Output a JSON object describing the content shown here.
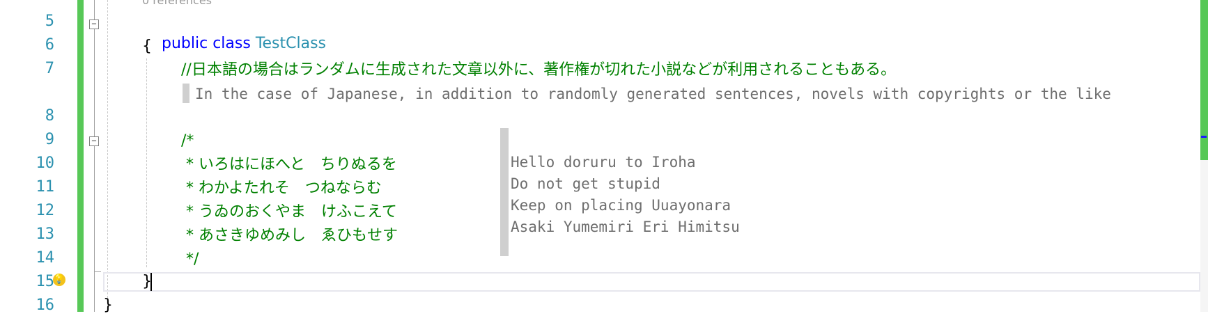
{
  "editor": {
    "codelens": "0 references",
    "line_numbers": [
      "5",
      "6",
      "7",
      "8",
      "9",
      "10",
      "11",
      "12",
      "13",
      "14",
      "15",
      "16"
    ],
    "line5": {
      "kw1": "public",
      "kw2": "class",
      "type_name": "TestClass"
    },
    "line6": "{",
    "line7_comment": "//日本語の場合はランダムに生成された文章以外に、著作権が切れた小説などが利用されることもある。",
    "line7_adornment": "In the case of Japanese, in addition to randomly generated sentences, novels with copyrights or the like",
    "line9": "/*",
    "line10": " * いろはにほへと　ちりぬるを",
    "line11": " * わかよたれそ　つねならむ",
    "line12": " * うゐのおくやま　けふこえて",
    "line13": " * あさきゆめみし　ゑひもせす",
    "line14": " */",
    "line15": "}",
    "line16": "}",
    "comment_adornment_lines": [
      "Hello doruru to Iroha",
      "Do not get stupid",
      "Keep on placing Uuayonara",
      "Asaki Yumemiri Eri Himitsu"
    ],
    "lightbulb_icon": "lightbulb-icon",
    "colors": {
      "keyword": "#0000ff",
      "type": "#2b91af",
      "comment": "#008000",
      "line_number": "#2b91af",
      "change_bar": "#57c857"
    }
  }
}
